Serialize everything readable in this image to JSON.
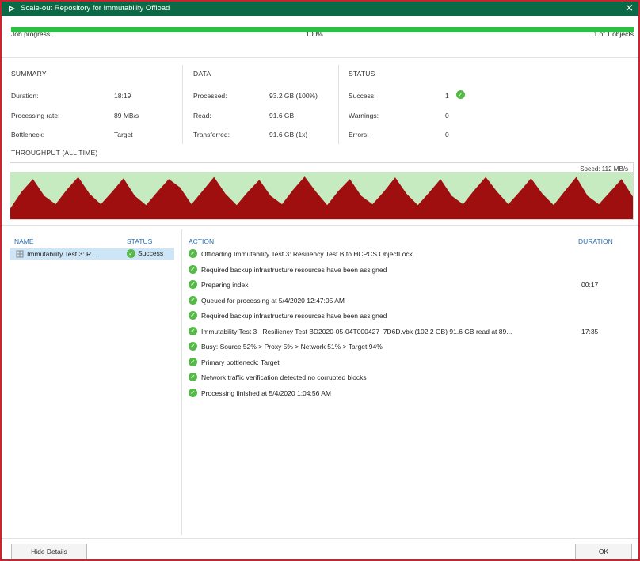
{
  "window": {
    "title": "Scale-out Repository for Immutability Offload",
    "close_glyph": "×"
  },
  "progress": {
    "label": "Job progress:",
    "percent_text": "100%",
    "objects_text": "1 of 1 objects",
    "fraction": 1.0,
    "color": "#2bc043"
  },
  "summary": {
    "title": "SUMMARY",
    "rows": [
      {
        "label": "Duration:",
        "value": "18:19"
      },
      {
        "label": "Processing rate:",
        "value": "89 MB/s"
      },
      {
        "label": "Bottleneck:",
        "value": "Target"
      }
    ]
  },
  "data": {
    "title": "DATA",
    "rows": [
      {
        "label": "Processed:",
        "value": "93.2 GB (100%)"
      },
      {
        "label": "Read:",
        "value": "91.6 GB"
      },
      {
        "label": "Transferred:",
        "value": "91.6 GB (1x)"
      }
    ]
  },
  "status": {
    "title": "STATUS",
    "rows": [
      {
        "label": "Success:",
        "value": "1"
      },
      {
        "label": "Warnings:",
        "value": "0"
      },
      {
        "label": "Errors:",
        "value": "0"
      }
    ],
    "success_icon": "check-circle-icon"
  },
  "throughput": {
    "title": "THROUGHPUT (ALL TIME)",
    "speed_label": "Speed: 112 MB/s",
    "colors": {
      "area": "#a00f0f",
      "background": "#c7ebc0"
    },
    "profile": [
      0.2,
      0.6,
      0.9,
      0.5,
      0.3,
      0.65,
      0.95,
      0.55,
      0.3,
      0.6,
      0.92,
      0.5,
      0.28,
      0.6,
      0.9,
      0.7,
      0.3,
      0.62,
      0.95,
      0.55,
      0.28,
      0.6,
      0.88,
      0.5,
      0.3,
      0.65,
      0.96,
      0.6,
      0.28,
      0.62,
      0.9,
      0.5,
      0.3,
      0.6,
      0.94,
      0.55,
      0.28,
      0.58,
      0.9,
      0.5,
      0.3,
      0.64,
      0.95,
      0.6,
      0.3,
      0.6,
      0.92,
      0.55,
      0.28,
      0.62,
      0.95,
      0.5,
      0.3,
      0.6,
      0.9,
      0.48
    ]
  },
  "list": {
    "name_header": "NAME",
    "status_header": "STATUS",
    "job_name": "Immutability Test 3: R...",
    "job_status": "Success",
    "job_icon": "vm-job-icon"
  },
  "actions": {
    "action_header": "ACTION",
    "duration_header": "DURATION",
    "items": [
      {
        "text": "Offloading Immutability Test 3: Resiliency Test B to HCPCS ObjectLock",
        "duration": ""
      },
      {
        "text": "Required backup infrastructure resources have been assigned",
        "duration": ""
      },
      {
        "text": "Preparing index",
        "duration": "00:17"
      },
      {
        "text": "Queued for processing at 5/4/2020 12:47:05 AM",
        "duration": ""
      },
      {
        "text": "Required backup infrastructure resources have been assigned",
        "duration": ""
      },
      {
        "text": "Immutability Test 3_ Resiliency Test BD2020-05-04T000427_7D6D.vbk (102.2 GB) 91.6 GB read at 89...",
        "duration": "17:35"
      },
      {
        "text": "Busy: Source 52% > Proxy 5% > Network 51% > Target 94%",
        "duration": ""
      },
      {
        "text": "Primary bottleneck: Target",
        "duration": ""
      },
      {
        "text": "Network traffic verification detected no corrupted blocks",
        "duration": ""
      },
      {
        "text": "Processing finished at 5/4/2020 1:04:56 AM",
        "duration": ""
      }
    ]
  },
  "buttons": {
    "hide_details": "Hide Details",
    "ok": "OK"
  }
}
